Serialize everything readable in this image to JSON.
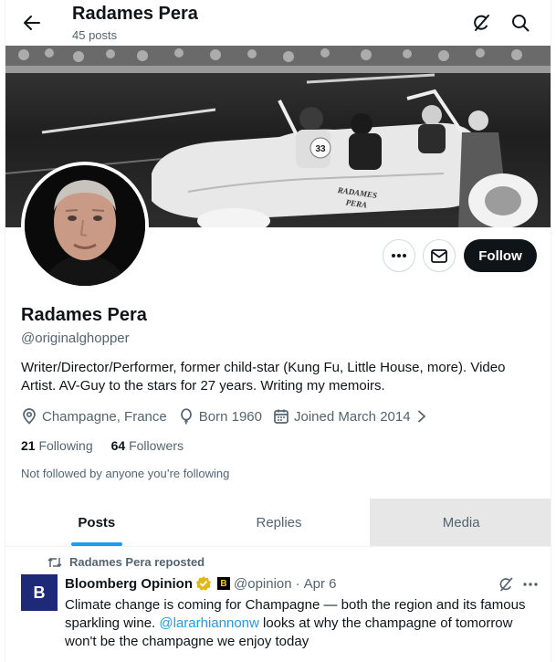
{
  "header": {
    "name": "Radames Pera",
    "posts_count": "45 posts"
  },
  "banner": {
    "car_number": "33",
    "door_text_line1": "RADAMES",
    "door_text_line2": "PERA"
  },
  "profile": {
    "name": "Radames Pera",
    "handle": "@originalghopper",
    "bio_line1": "Writer/Director/Performer, former child-star (Kung Fu, Little House, more). Video",
    "bio_line2": "Artist. AV-Guy to the stars for 27 years. Writing my memoirs.",
    "location": "Champagne, France",
    "born": "Born 1960",
    "joined": "Joined March 2014",
    "following_count": "21",
    "following_label": "Following",
    "followers_count": "64",
    "followers_label": "Followers",
    "not_followed": "Not followed by anyone you’re following"
  },
  "actions": {
    "follow_label": "Follow"
  },
  "tabs": [
    {
      "label": "Posts",
      "active": true
    },
    {
      "label": "Replies",
      "active": false
    },
    {
      "label": "Media",
      "active": false
    }
  ],
  "tweet": {
    "repost_label": "Radames Pera reposted",
    "avatar_letter": "B",
    "author_name": "Bloomberg Opinion",
    "badge_letter": "B",
    "author_handle": "@opinion",
    "separator": "·",
    "date": "Apr 6",
    "text_line1": "Climate change is coming for Champagne — both the region and its famous",
    "text_line2_a": "sparkling wine. ",
    "text_line2_mention": "@lararhiannonw",
    "text_line2_b": " looks at why the champagne of tomorrow",
    "text_line3": "won't be the champagne we enjoy today"
  },
  "colors": {
    "accent": "#1d9bf0",
    "text_primary": "#0f1419",
    "text_secondary": "#536471",
    "follow_button": "#0f1419",
    "verified_gold": "#e2b719",
    "bloomberg_avatar": "#1e2a78"
  },
  "icons": {
    "back": "arrow-left-icon",
    "grok": "grok-icon",
    "search": "search-icon",
    "more": "more-icon",
    "message": "envelope-icon",
    "location": "location-pin-icon",
    "birthday": "balloon-icon",
    "joined": "calendar-icon",
    "repost": "repost-icon"
  }
}
